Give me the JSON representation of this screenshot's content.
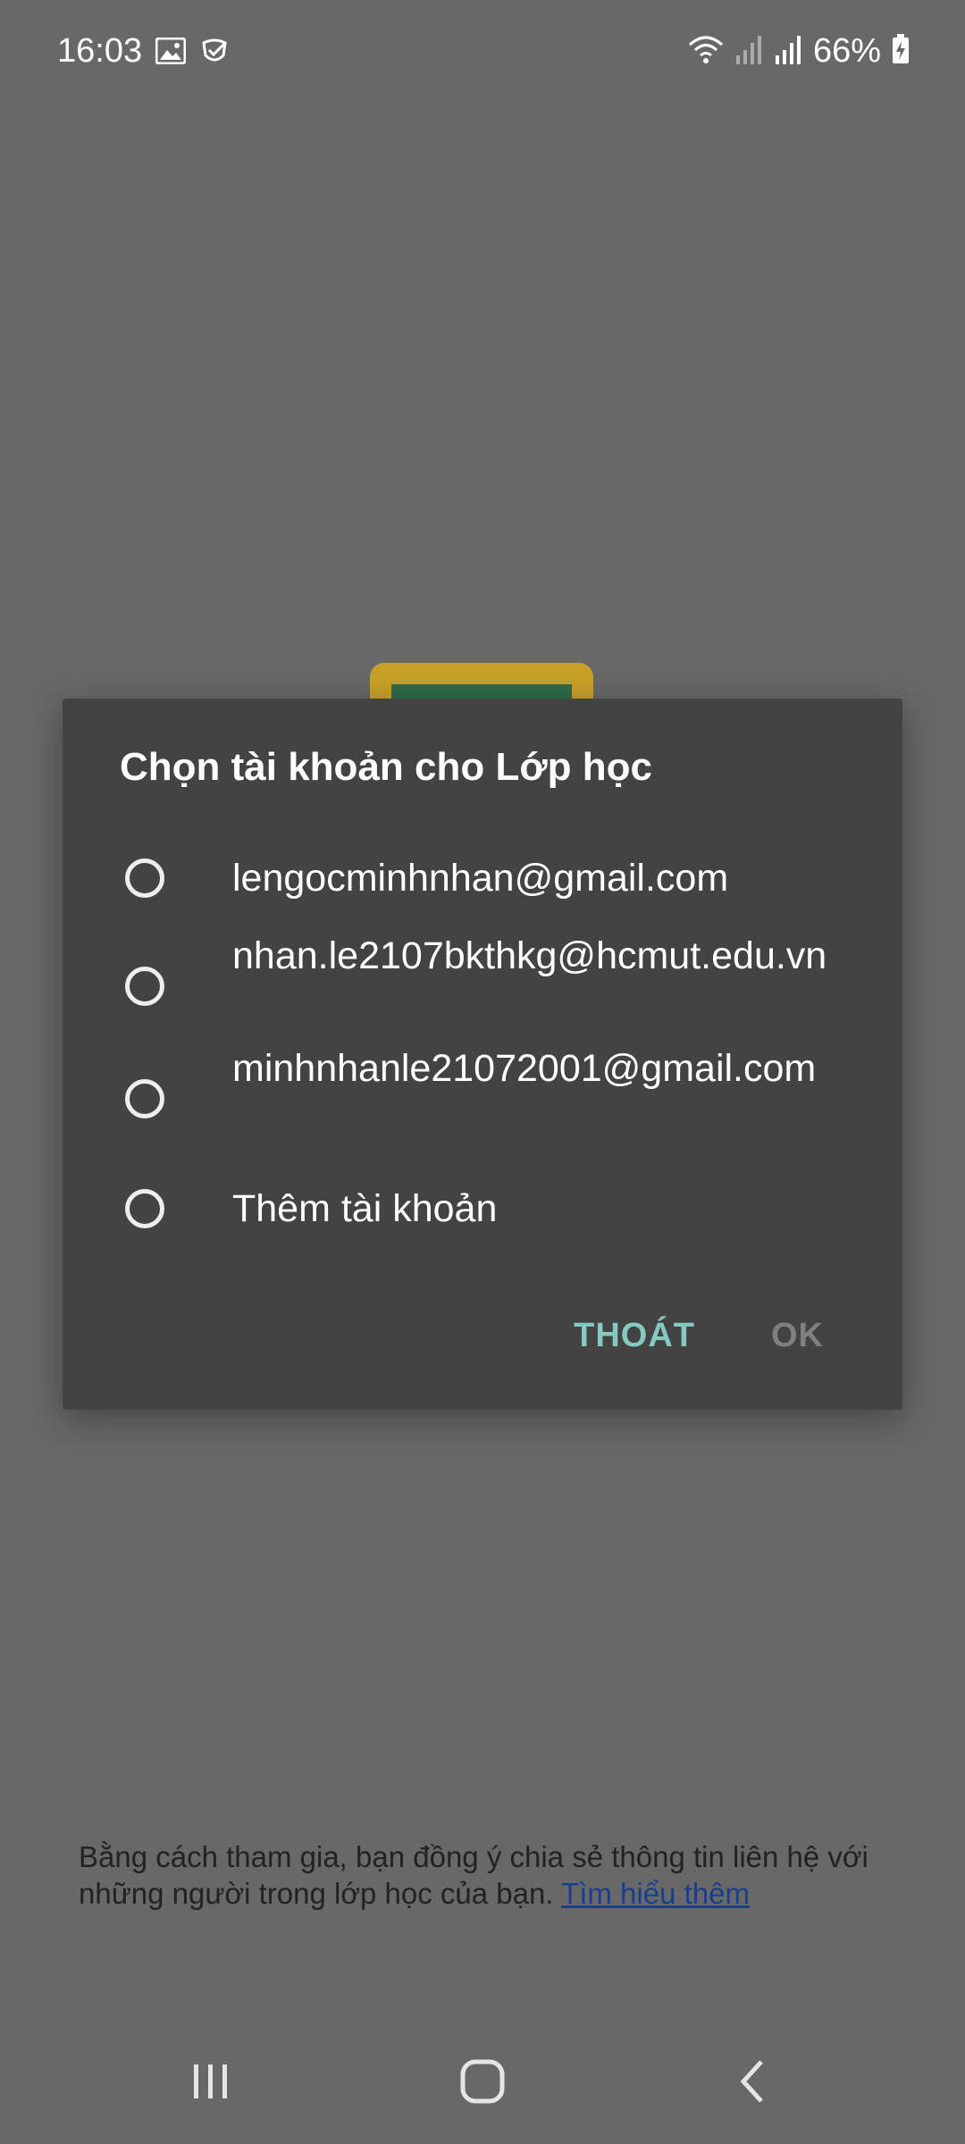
{
  "status_bar": {
    "time": "16:03",
    "battery": "66%",
    "icons": [
      "image-icon",
      "shield-icon",
      "wifi-icon",
      "signal-icon",
      "signal-icon",
      "battery-charging-icon"
    ]
  },
  "dialog": {
    "title": "Chọn tài khoản cho Lớp học",
    "options": [
      {
        "label": "lengocminhnhan@gmail.com",
        "selected": false
      },
      {
        "label": "nhan.le2107bkthkg@hcmut.edu.vn",
        "selected": false
      },
      {
        "label": "minhnhanle21072001@gmail.com",
        "selected": false
      },
      {
        "label": "Thêm tài khoản",
        "selected": false
      }
    ],
    "cancel_label": "THOÁT",
    "ok_label": "OK"
  },
  "footer": {
    "text": "Bằng cách tham gia, bạn đồng ý chia sẻ thông tin liên hệ với những người trong lớp học của bạn. ",
    "link": "Tìm hiểu thêm"
  },
  "nav_bar": {
    "icons": [
      "recent-apps-icon",
      "home-icon",
      "back-icon"
    ]
  },
  "colors": {
    "background": "#686868",
    "dialog": "#434343",
    "accent": "#86c9c1"
  }
}
